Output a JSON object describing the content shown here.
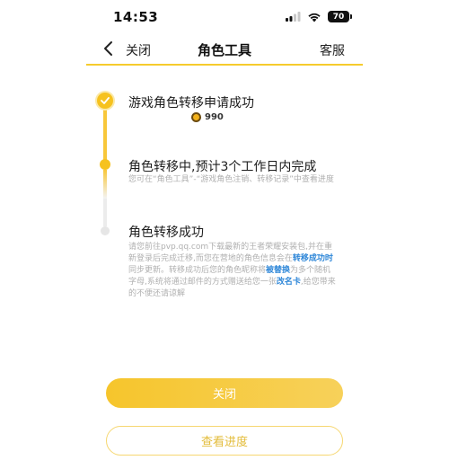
{
  "status_bar": {
    "time": "14:53",
    "battery": "70",
    "signal_icon": "cellular-signal-icon",
    "wifi_icon": "wifi-icon",
    "battery_icon": "battery-icon"
  },
  "nav": {
    "back_icon": "chevron-left-icon",
    "close_label": "关闭",
    "title": "角色工具",
    "service_label": "客服"
  },
  "steps": [
    {
      "title": "游戏角色转移申请成功",
      "coin_icon": "coin-icon",
      "coin_amount": "990",
      "state": "done"
    },
    {
      "title": "角色转移中,预计3个工作日内完成",
      "desc": "您可在“角色工具”-“游戏角色注销、转移记录”中查看进度",
      "state": "active"
    },
    {
      "title": "角色转移成功",
      "desc": {
        "p1": "请您前往pvp.qq.com下载最新的王者荣耀安装包,并在重新登录后完成迁移,而您在营地的角色信息会在",
        "h1": "转移成功时",
        "p2": "同步更新。转移成功后您的角色昵称将",
        "h2": "被替换",
        "p3": "为多个随机字母,系统将通过邮件的方式赠送给您一张",
        "h3": "改名卡",
        "p4": ",给您带来的不便还请谅解"
      },
      "state": "pending"
    }
  ],
  "buttons": {
    "close_label": "关闭",
    "progress_label": "查看进度"
  },
  "colors": {
    "accent": "#f6c21f",
    "highlight": "#2f87d8",
    "muted_text": "#b0b0b0"
  }
}
